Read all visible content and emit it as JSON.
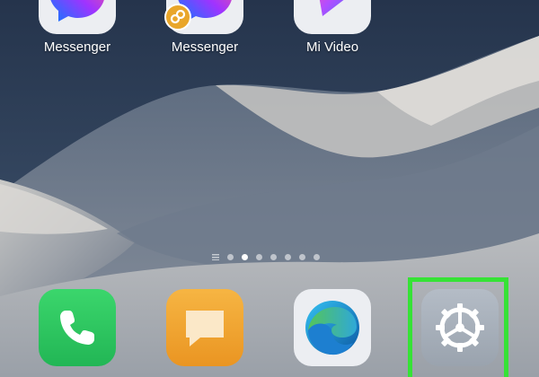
{
  "home_screen": {
    "top_row": [
      {
        "label": "Messenger",
        "icon": "messenger-icon"
      },
      {
        "label": "Messenger",
        "icon": "messenger-dual-icon"
      },
      {
        "label": "Mi Video",
        "icon": "mi-video-icon"
      }
    ],
    "page_indicator": {
      "total": 8,
      "active": 2
    },
    "dock": [
      {
        "icon": "phone-icon"
      },
      {
        "icon": "messages-icon"
      },
      {
        "icon": "edge-browser-icon"
      },
      {
        "icon": "settings-gear-icon"
      }
    ],
    "highlight": "settings"
  },
  "colors": {
    "highlight": "#36e236",
    "phone": "#2fc860",
    "messages": "#f0a030",
    "settings": "#a9b2bd"
  }
}
